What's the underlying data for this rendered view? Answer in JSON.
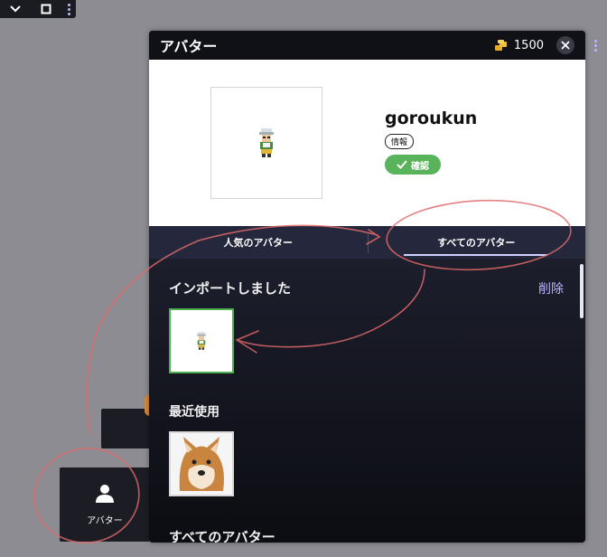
{
  "panel": {
    "title": "アバター",
    "coins": "1500"
  },
  "profile": {
    "username": "goroukun",
    "info_tag": "情報",
    "confirm_label": "確認"
  },
  "tabs": [
    {
      "label": "人気のアバター",
      "active": false
    },
    {
      "label": "すべてのアバター",
      "active": true
    }
  ],
  "sections": {
    "imported": {
      "title": "インポートしました",
      "action": "削除"
    },
    "recent": {
      "title": "最近使用"
    },
    "all": {
      "title": "すべてのアバター"
    }
  },
  "sidebar_tile": {
    "label": "アバター"
  },
  "colors": {
    "accent": "#b9b6ff",
    "confirm": "#58b35b",
    "selected_border": "#4caf50",
    "annotation": "#e06a6a"
  },
  "icons": {
    "mini_bar": [
      "chevron-down-icon",
      "maximize-icon",
      "more-vertical-icon"
    ],
    "coin": "coin-stack-icon",
    "close": "close-icon",
    "confirm": "checkmark-icon",
    "person": "person-icon"
  }
}
